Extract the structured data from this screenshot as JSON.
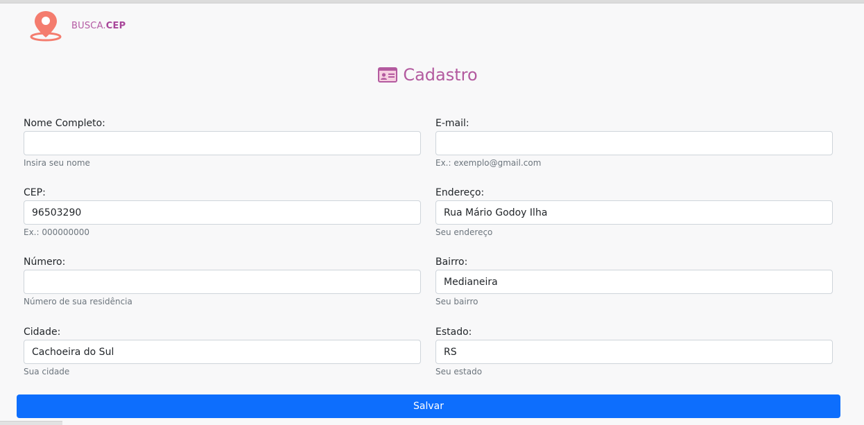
{
  "brand": {
    "name_prefix": "BUSCA.",
    "name_suffix": "CEP",
    "icon": "map-pin-icon"
  },
  "page": {
    "title": "Cadastro",
    "title_icon": "id-card-icon"
  },
  "form": {
    "nome": {
      "label": "Nome Completo:",
      "value": "",
      "help": "Insira seu nome"
    },
    "email": {
      "label": "E-mail:",
      "value": "",
      "help": "Ex.: exemplo@gmail.com"
    },
    "cep": {
      "label": "CEP:",
      "value": "96503290",
      "help": "Ex.: 000000000"
    },
    "endereco": {
      "label": "Endereço:",
      "value": "Rua Mário Godoy Ilha",
      "help": "Seu endereço"
    },
    "numero": {
      "label": "Número:",
      "value": "",
      "help": "Número de sua residência"
    },
    "bairro": {
      "label": "Bairro:",
      "value": "Medianeira",
      "help": "Seu bairro"
    },
    "cidade": {
      "label": "Cidade:",
      "value": "Cachoeira do Sul",
      "help": "Sua cidade"
    },
    "estado": {
      "label": "Estado:",
      "value": "RS",
      "help": "Seu estado"
    },
    "submit_label": "Salvar"
  },
  "colors": {
    "brand": "#b35a9f",
    "pin": "#f47c6e",
    "primary": "#0d6efd",
    "background": "#f8f8f9"
  }
}
